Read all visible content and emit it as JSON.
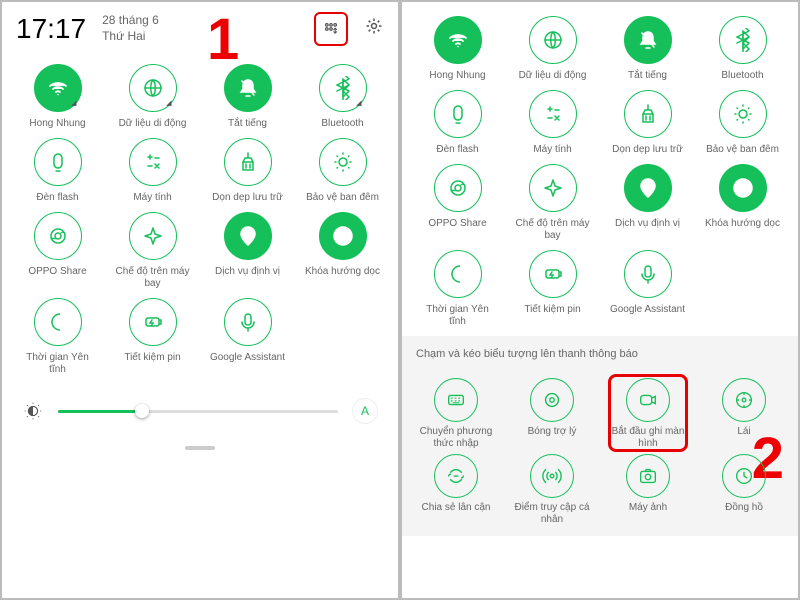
{
  "header": {
    "time": "17:17",
    "date_top": "28 tháng 6",
    "date_bot": "Thứ Hai"
  },
  "markers": {
    "one": "1",
    "two": "2"
  },
  "p1_tiles": [
    {
      "l": "Hong Nhung",
      "on": true,
      "i": "wifi",
      "corner": "◢"
    },
    {
      "l": "Dữ liệu di động",
      "on": false,
      "i": "globe",
      "corner": "◢"
    },
    {
      "l": "Tắt tiếng",
      "on": true,
      "i": "bell",
      "corner": ""
    },
    {
      "l": "Bluetooth",
      "on": false,
      "i": "bt",
      "corner": "◢"
    },
    {
      "l": "Đèn flash",
      "on": false,
      "i": "flash",
      "corner": ""
    },
    {
      "l": "Máy tính",
      "on": false,
      "i": "calc",
      "corner": ""
    },
    {
      "l": "Dọn dẹp lưu trữ",
      "on": false,
      "i": "clean",
      "corner": ""
    },
    {
      "l": "Bảo vệ ban đêm",
      "on": false,
      "i": "night",
      "corner": ""
    },
    {
      "l": "OPPO Share",
      "on": false,
      "i": "share",
      "corner": ""
    },
    {
      "l": "Chế độ trên máy bay",
      "on": false,
      "i": "plane",
      "corner": ""
    },
    {
      "l": "Dịch vụ định vị",
      "on": true,
      "i": "loc",
      "corner": ""
    },
    {
      "l": "Khóa hướng dọc",
      "on": true,
      "i": "lock",
      "corner": ""
    },
    {
      "l": "Thời gian Yên tĩnh",
      "on": false,
      "i": "moon",
      "corner": ""
    },
    {
      "l": "Tiết kiệm pin",
      "on": false,
      "i": "bat",
      "corner": ""
    },
    {
      "l": "Google Assistant",
      "on": false,
      "i": "mic",
      "corner": ""
    }
  ],
  "auto": "A",
  "p2_top": [
    {
      "l": "Hong Nhung",
      "on": true,
      "i": "wifi"
    },
    {
      "l": "Dữ liệu di động",
      "on": false,
      "i": "globe"
    },
    {
      "l": "Tắt tiếng",
      "on": true,
      "i": "bell"
    },
    {
      "l": "Bluetooth",
      "on": false,
      "i": "bt"
    },
    {
      "l": "Đèn flash",
      "on": false,
      "i": "flash"
    },
    {
      "l": "Máy tính",
      "on": false,
      "i": "calc"
    },
    {
      "l": "Dọn dẹp lưu trữ",
      "on": false,
      "i": "clean"
    },
    {
      "l": "Bảo vệ ban đêm",
      "on": false,
      "i": "night"
    },
    {
      "l": "OPPO Share",
      "on": false,
      "i": "share"
    },
    {
      "l": "Chế độ trên máy bay",
      "on": false,
      "i": "plane"
    },
    {
      "l": "Dịch vụ định vị",
      "on": true,
      "i": "loc"
    },
    {
      "l": "Khóa hướng dọc",
      "on": true,
      "i": "lock"
    },
    {
      "l": "Thời gian Yên tĩnh",
      "on": false,
      "i": "moon"
    },
    {
      "l": "Tiết kiệm pin",
      "on": false,
      "i": "bat"
    },
    {
      "l": "Google Assistant",
      "on": false,
      "i": "mic"
    }
  ],
  "hint": "Chạm và kéo biểu tượng lên thanh thông báo",
  "p2_bot": [
    {
      "l": "Chuyển phương thức nhập",
      "i": "kb",
      "hl": false
    },
    {
      "l": "Bóng trợ lý",
      "i": "ball",
      "hl": false
    },
    {
      "l": "Bắt đầu ghi màn hình",
      "i": "rec",
      "hl": true
    },
    {
      "l": "Lái",
      "i": "car",
      "hl": false
    },
    {
      "l": "Chia sẻ lân cận",
      "i": "near",
      "hl": false
    },
    {
      "l": "Điểm truy cập cá nhân",
      "i": "hot",
      "hl": false
    },
    {
      "l": "Máy ảnh",
      "i": "cam",
      "hl": false
    },
    {
      "l": "Đồng hồ",
      "i": "clk",
      "hl": false
    }
  ]
}
